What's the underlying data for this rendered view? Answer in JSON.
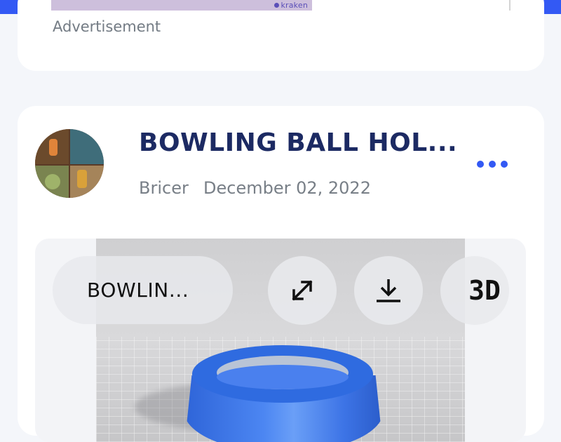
{
  "colors": {
    "accent": "#3359f4",
    "title": "#1c2a63",
    "muted": "#787f87",
    "model_blue": "#3d74e6"
  },
  "ad": {
    "brand": "kraken",
    "label": "Advertisement"
  },
  "post": {
    "title": "BOWLING BALL HOL...",
    "author": "Bricer",
    "date": "December 02, 2022",
    "more_icon": "more-dots-icon"
  },
  "viewer": {
    "model_title": "BOWLIN...",
    "expand_icon": "expand-icon",
    "download_icon": "download-icon",
    "mode_label": "3D"
  }
}
